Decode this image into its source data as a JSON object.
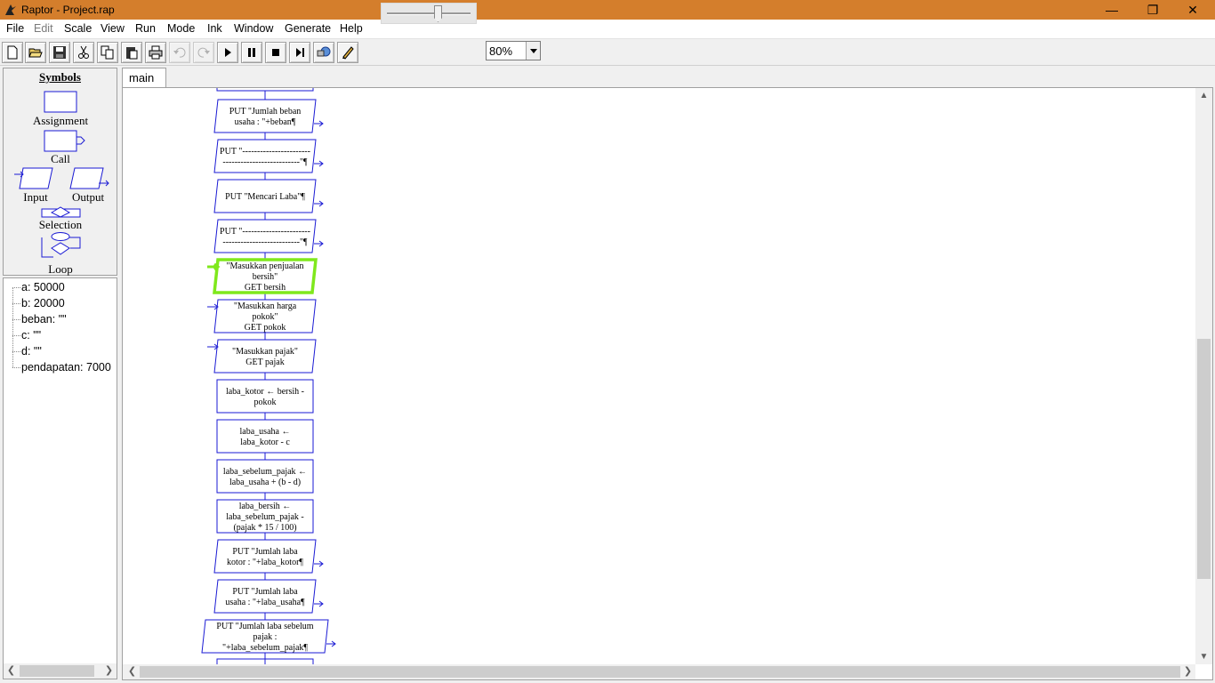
{
  "window": {
    "title": "Raptor - Project.rap"
  },
  "menu": [
    "File",
    "Edit",
    "Scale",
    "View",
    "Run",
    "Mode",
    "Ink",
    "Window",
    "Generate",
    "Help"
  ],
  "toolbar": {
    "zoom": "80%"
  },
  "symbols": {
    "header": "Symbols",
    "assignment": "Assignment",
    "call": "Call",
    "input": "Input",
    "output": "Output",
    "selection": "Selection",
    "loop": "Loop"
  },
  "variables": [
    "a: 50000",
    "b: 20000",
    "beban: \"\"",
    "c: \"\"",
    "d: \"\"",
    "pendapatan: 7000"
  ],
  "tabs": {
    "main": "main"
  },
  "flowchart": [
    {
      "kind": "output",
      "lines": [
        "PUT \"Jumlah beban",
        "usaha : \"+beban¶"
      ]
    },
    {
      "kind": "output",
      "lines": [
        "PUT \"-----------------------",
        "--------------------------\"¶"
      ]
    },
    {
      "kind": "output",
      "lines": [
        "PUT \"Mencari Laba\"¶"
      ]
    },
    {
      "kind": "output",
      "lines": [
        "PUT \"-----------------------",
        "--------------------------\"¶"
      ]
    },
    {
      "kind": "input",
      "lines": [
        "\"Masukkan penjualan",
        "bersih\"",
        "GET bersih"
      ],
      "selected": true
    },
    {
      "kind": "input",
      "lines": [
        "\"Masukkan harga",
        "pokok\"",
        "GET pokok"
      ]
    },
    {
      "kind": "input",
      "lines": [
        "\"Masukkan pajak\"",
        "GET pajak"
      ]
    },
    {
      "kind": "assign",
      "lines": [
        "laba_kotor ← bersih -",
        "pokok"
      ]
    },
    {
      "kind": "assign",
      "lines": [
        "laba_usaha ←",
        "laba_kotor - c"
      ]
    },
    {
      "kind": "assign",
      "lines": [
        "laba_sebelum_pajak ←",
        "laba_usaha + (b - d)"
      ]
    },
    {
      "kind": "assign",
      "lines": [
        "laba_bersih ←",
        "laba_sebelum_pajak -",
        "(pajak * 15 / 100)"
      ]
    },
    {
      "kind": "output",
      "lines": [
        "PUT \"Jumlah laba",
        "kotor : \"+laba_kotor¶"
      ]
    },
    {
      "kind": "output",
      "lines": [
        "PUT \"Jumlah laba",
        "usaha : \"+laba_usaha¶"
      ]
    },
    {
      "kind": "output",
      "lines": [
        "PUT \"Jumlah laba sebelum",
        "pajak :",
        "\"+laba_sebelum_pajak¶"
      ],
      "wide": true
    }
  ]
}
